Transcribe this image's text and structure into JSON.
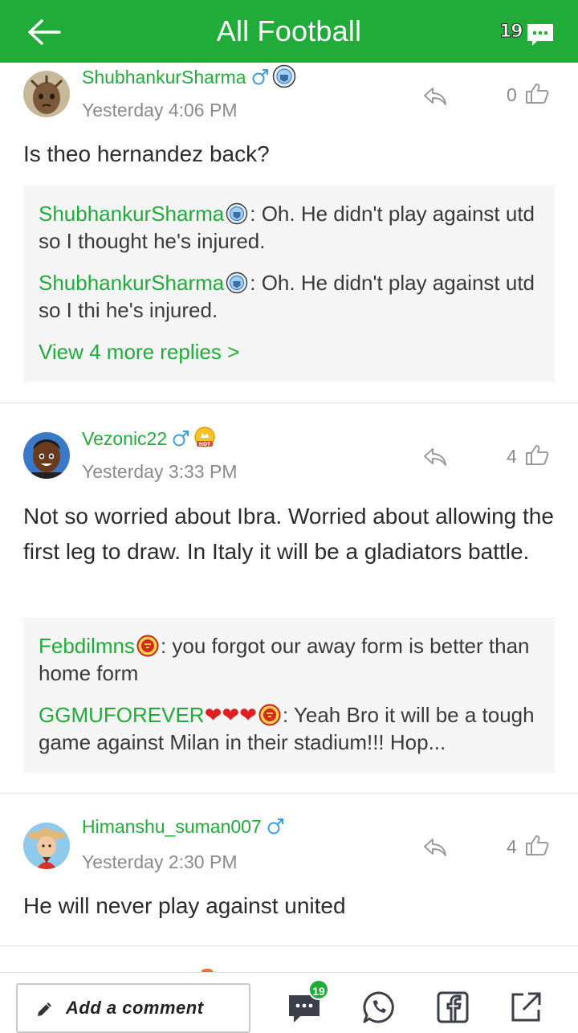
{
  "header": {
    "title": "All Football",
    "message_count": "19",
    "back_icon": "arrow-left-icon",
    "message_icon": "chat-bubble-icon"
  },
  "comments": [
    {
      "username": "ShubhankurSharma",
      "timestamp": "Yesterday 4:06 PM",
      "likes": "0",
      "text": "Is theo hernandez back?",
      "replies": [
        {
          "name": "ShubhankurSharma",
          "text": ": Oh. He didn't play against utd so I thought he's injured."
        },
        {
          "name": "ShubhankurSharma",
          "text": ": Oh. He didn't play against utd so I thi he's injured."
        }
      ],
      "more_replies": "View 4 more replies >"
    },
    {
      "username": "Vezonic22",
      "timestamp": "Yesterday 3:33 PM",
      "likes": "4",
      "text": "Not so worried about Ibra. Worried about allowing the first leg to draw. In Italy it will be a gladiators battle.",
      "replies": [
        {
          "name": "Febdilmns",
          "text": ": you forgot our away form is better than home form"
        },
        {
          "name": "GGMUFOREVER",
          "hearts": "❤❤❤",
          "text": ": Yeah Bro it will be a tough game against Milan in their stadium!!! Hop..."
        }
      ]
    },
    {
      "username": "Himanshu_suman007",
      "timestamp": "Yesterday 2:30 PM",
      "likes": "4",
      "text": "He will never play against united"
    }
  ],
  "bottom_bar": {
    "add_comment_label": "Add a comment",
    "comments_count": "19"
  },
  "colors": {
    "brand_green": "#21ac3a",
    "reply_bg": "#f5f5f5",
    "timestamp_gray": "#8a8a8a"
  }
}
